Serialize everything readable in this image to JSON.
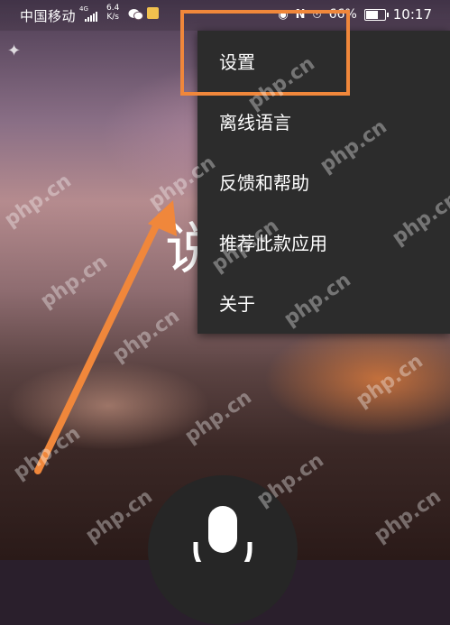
{
  "status_bar": {
    "carrier": "中国移动",
    "network_type": "4G",
    "speed_value": "6.4",
    "speed_unit": "K/s",
    "battery_percent": "66%",
    "time": "10:17"
  },
  "main": {
    "partial_heading": "说"
  },
  "overflow_menu": {
    "items": [
      {
        "label": "设置"
      },
      {
        "label": "离线语言"
      },
      {
        "label": "反馈和帮助"
      },
      {
        "label": "推荐此款应用"
      },
      {
        "label": "关于"
      }
    ]
  },
  "annotation": {
    "highlight_color": "#f0873b"
  },
  "watermark": {
    "text": "php.cn"
  },
  "colors": {
    "menu_background": "#2c2c2c",
    "menu_text": "#ffffff",
    "mic_button": "#262626"
  }
}
